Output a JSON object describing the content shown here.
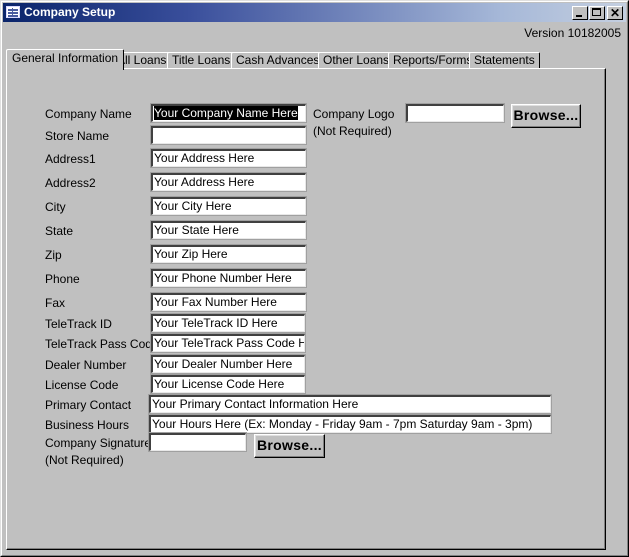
{
  "window": {
    "title": "Company Setup",
    "version": "Version 10182005",
    "controls": {
      "minimize": "_",
      "maximize": "□",
      "close": "✕"
    }
  },
  "tabs": [
    {
      "label": "General Information",
      "active": true
    },
    {
      "label": "All Loans",
      "active": false
    },
    {
      "label": "Title Loans",
      "active": false
    },
    {
      "label": "Cash Advances",
      "active": false
    },
    {
      "label": "Other Loans",
      "active": false
    },
    {
      "label": "Reports/Forms",
      "active": false
    },
    {
      "label": "Statements",
      "active": false
    }
  ],
  "form": {
    "company_name": {
      "label": "Company Name",
      "value": "Your Company Name Here"
    },
    "store_name": {
      "label": "Store Name",
      "value": ""
    },
    "address1": {
      "label": "Address1",
      "value": "Your Address Here"
    },
    "address2": {
      "label": "Address2",
      "value": "Your Address Here"
    },
    "city": {
      "label": "City",
      "value": "Your City Here"
    },
    "state": {
      "label": "State",
      "value": "Your State Here"
    },
    "zip": {
      "label": "Zip",
      "value": "Your Zip Here"
    },
    "phone": {
      "label": "Phone",
      "value": "Your Phone Number Here"
    },
    "fax": {
      "label": "Fax",
      "value": "Your Fax Number Here"
    },
    "teletrack_id": {
      "label": "TeleTrack ID",
      "value": "Your TeleTrack ID Here"
    },
    "teletrack_pass_code": {
      "label": "TeleTrack Pass Code",
      "value": "Your TeleTrack Pass Code Her"
    },
    "dealer_number": {
      "label": "Dealer Number",
      "value": "Your Dealer Number Here"
    },
    "license_code": {
      "label": "License Code",
      "value": "Your License Code Here"
    },
    "primary_contact": {
      "label": "Primary Contact",
      "value": "Your Primary Contact Information Here"
    },
    "business_hours": {
      "label": "Business Hours",
      "value": "Your Hours Here (Ex: Monday - Friday 9am - 7pm   Saturday 9am - 3pm)"
    },
    "company_signature": {
      "label": "Company Signature",
      "note": "(Not Required)",
      "value": "",
      "browse_label": "Browse..."
    },
    "company_logo": {
      "label": "Company Logo",
      "note": "(Not Required)",
      "value": "",
      "browse_label": "Browse..."
    }
  }
}
